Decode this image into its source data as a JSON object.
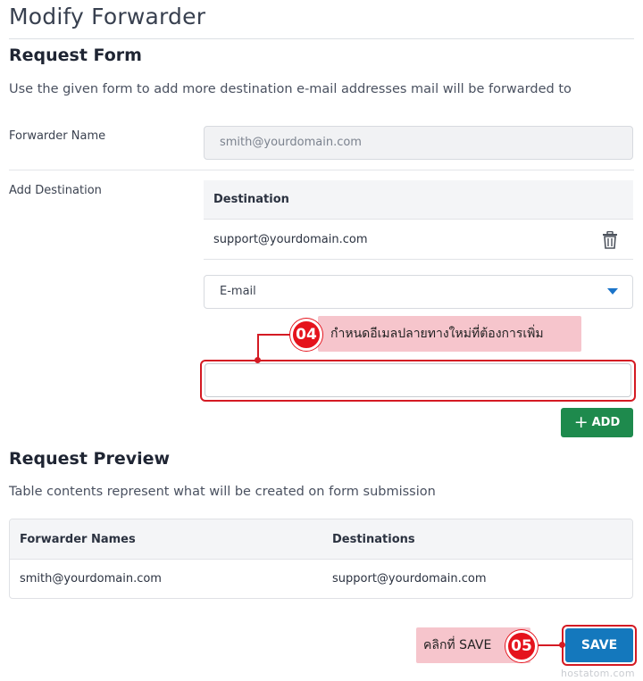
{
  "page": {
    "title": "Modify Forwarder"
  },
  "request_form": {
    "heading": "Request Form",
    "description": "Use the given form to add more destination e-mail addresses mail will be forwarded to",
    "forwarder_name_label": "Forwarder Name",
    "forwarder_name_value": "smith@yourdomain.com",
    "add_destination_label": "Add Destination",
    "destination_table": {
      "header": "Destination",
      "rows": [
        {
          "value": "support@yourdomain.com",
          "action_icon": "trash-icon"
        }
      ]
    },
    "type_select": {
      "value": "E-mail",
      "icon": "chevron-down-icon"
    },
    "new_destination_input": {
      "value": "",
      "placeholder": ""
    },
    "add_button_label": "ADD",
    "add_button_icon": "plus-icon"
  },
  "annotations": {
    "step_04": {
      "number": "04",
      "text": "กำหนดอีเมลปลายทางใหม่ที่ต้องการเพิ่ม"
    },
    "step_05": {
      "number": "05",
      "text": "คลิกที่ SAVE"
    },
    "color": "#e5131c",
    "background": "#f6c5cc"
  },
  "request_preview": {
    "heading": "Request Preview",
    "description": "Table contents represent what will be created on form submission",
    "columns": [
      "Forwarder Names",
      "Destinations"
    ],
    "rows": [
      [
        "smith@yourdomain.com",
        "support@yourdomain.com"
      ]
    ]
  },
  "save_button_label": "SAVE",
  "watermark": "hostatom.com",
  "colors": {
    "add_button": "#1e8a4d",
    "save_button": "#1478bd",
    "highlight": "#d41a23",
    "select_caret": "#1b74c9"
  }
}
